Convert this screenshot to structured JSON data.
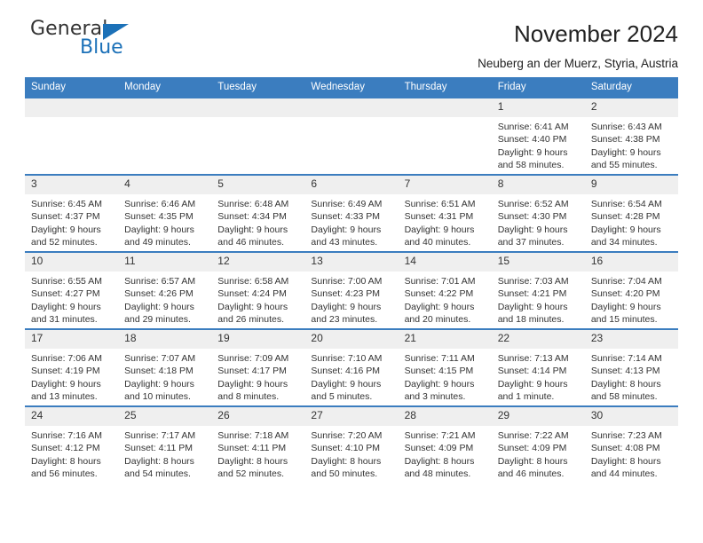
{
  "logo": {
    "word_one": "General",
    "word_two": "Blue",
    "triangle": "triangle-mark",
    "accent_color": "#1c71b8"
  },
  "header": {
    "title": "November 2024",
    "subtitle": "Neuberg an der Muerz, Styria, Austria"
  },
  "theme": {
    "header_blue": "#3b7dbf",
    "daynum_band": "#efefef",
    "text": "#333333"
  },
  "weekday_headers": [
    "Sunday",
    "Monday",
    "Tuesday",
    "Wednesday",
    "Thursday",
    "Friday",
    "Saturday"
  ],
  "weeks": [
    [
      {
        "day": "",
        "empty": true,
        "sunrise": "",
        "sunset": "",
        "daylight_line1": "",
        "daylight_line2": ""
      },
      {
        "day": "",
        "empty": true,
        "sunrise": "",
        "sunset": "",
        "daylight_line1": "",
        "daylight_line2": ""
      },
      {
        "day": "",
        "empty": true,
        "sunrise": "",
        "sunset": "",
        "daylight_line1": "",
        "daylight_line2": ""
      },
      {
        "day": "",
        "empty": true,
        "sunrise": "",
        "sunset": "",
        "daylight_line1": "",
        "daylight_line2": ""
      },
      {
        "day": "",
        "empty": true,
        "sunrise": "",
        "sunset": "",
        "daylight_line1": "",
        "daylight_line2": ""
      },
      {
        "day": "1",
        "empty": false,
        "sunrise": "Sunrise: 6:41 AM",
        "sunset": "Sunset: 4:40 PM",
        "daylight_line1": "Daylight: 9 hours",
        "daylight_line2": "and 58 minutes."
      },
      {
        "day": "2",
        "empty": false,
        "sunrise": "Sunrise: 6:43 AM",
        "sunset": "Sunset: 4:38 PM",
        "daylight_line1": "Daylight: 9 hours",
        "daylight_line2": "and 55 minutes."
      }
    ],
    [
      {
        "day": "3",
        "empty": false,
        "sunrise": "Sunrise: 6:45 AM",
        "sunset": "Sunset: 4:37 PM",
        "daylight_line1": "Daylight: 9 hours",
        "daylight_line2": "and 52 minutes."
      },
      {
        "day": "4",
        "empty": false,
        "sunrise": "Sunrise: 6:46 AM",
        "sunset": "Sunset: 4:35 PM",
        "daylight_line1": "Daylight: 9 hours",
        "daylight_line2": "and 49 minutes."
      },
      {
        "day": "5",
        "empty": false,
        "sunrise": "Sunrise: 6:48 AM",
        "sunset": "Sunset: 4:34 PM",
        "daylight_line1": "Daylight: 9 hours",
        "daylight_line2": "and 46 minutes."
      },
      {
        "day": "6",
        "empty": false,
        "sunrise": "Sunrise: 6:49 AM",
        "sunset": "Sunset: 4:33 PM",
        "daylight_line1": "Daylight: 9 hours",
        "daylight_line2": "and 43 minutes."
      },
      {
        "day": "7",
        "empty": false,
        "sunrise": "Sunrise: 6:51 AM",
        "sunset": "Sunset: 4:31 PM",
        "daylight_line1": "Daylight: 9 hours",
        "daylight_line2": "and 40 minutes."
      },
      {
        "day": "8",
        "empty": false,
        "sunrise": "Sunrise: 6:52 AM",
        "sunset": "Sunset: 4:30 PM",
        "daylight_line1": "Daylight: 9 hours",
        "daylight_line2": "and 37 minutes."
      },
      {
        "day": "9",
        "empty": false,
        "sunrise": "Sunrise: 6:54 AM",
        "sunset": "Sunset: 4:28 PM",
        "daylight_line1": "Daylight: 9 hours",
        "daylight_line2": "and 34 minutes."
      }
    ],
    [
      {
        "day": "10",
        "empty": false,
        "sunrise": "Sunrise: 6:55 AM",
        "sunset": "Sunset: 4:27 PM",
        "daylight_line1": "Daylight: 9 hours",
        "daylight_line2": "and 31 minutes."
      },
      {
        "day": "11",
        "empty": false,
        "sunrise": "Sunrise: 6:57 AM",
        "sunset": "Sunset: 4:26 PM",
        "daylight_line1": "Daylight: 9 hours",
        "daylight_line2": "and 29 minutes."
      },
      {
        "day": "12",
        "empty": false,
        "sunrise": "Sunrise: 6:58 AM",
        "sunset": "Sunset: 4:24 PM",
        "daylight_line1": "Daylight: 9 hours",
        "daylight_line2": "and 26 minutes."
      },
      {
        "day": "13",
        "empty": false,
        "sunrise": "Sunrise: 7:00 AM",
        "sunset": "Sunset: 4:23 PM",
        "daylight_line1": "Daylight: 9 hours",
        "daylight_line2": "and 23 minutes."
      },
      {
        "day": "14",
        "empty": false,
        "sunrise": "Sunrise: 7:01 AM",
        "sunset": "Sunset: 4:22 PM",
        "daylight_line1": "Daylight: 9 hours",
        "daylight_line2": "and 20 minutes."
      },
      {
        "day": "15",
        "empty": false,
        "sunrise": "Sunrise: 7:03 AM",
        "sunset": "Sunset: 4:21 PM",
        "daylight_line1": "Daylight: 9 hours",
        "daylight_line2": "and 18 minutes."
      },
      {
        "day": "16",
        "empty": false,
        "sunrise": "Sunrise: 7:04 AM",
        "sunset": "Sunset: 4:20 PM",
        "daylight_line1": "Daylight: 9 hours",
        "daylight_line2": "and 15 minutes."
      }
    ],
    [
      {
        "day": "17",
        "empty": false,
        "sunrise": "Sunrise: 7:06 AM",
        "sunset": "Sunset: 4:19 PM",
        "daylight_line1": "Daylight: 9 hours",
        "daylight_line2": "and 13 minutes."
      },
      {
        "day": "18",
        "empty": false,
        "sunrise": "Sunrise: 7:07 AM",
        "sunset": "Sunset: 4:18 PM",
        "daylight_line1": "Daylight: 9 hours",
        "daylight_line2": "and 10 minutes."
      },
      {
        "day": "19",
        "empty": false,
        "sunrise": "Sunrise: 7:09 AM",
        "sunset": "Sunset: 4:17 PM",
        "daylight_line1": "Daylight: 9 hours",
        "daylight_line2": "and 8 minutes."
      },
      {
        "day": "20",
        "empty": false,
        "sunrise": "Sunrise: 7:10 AM",
        "sunset": "Sunset: 4:16 PM",
        "daylight_line1": "Daylight: 9 hours",
        "daylight_line2": "and 5 minutes."
      },
      {
        "day": "21",
        "empty": false,
        "sunrise": "Sunrise: 7:11 AM",
        "sunset": "Sunset: 4:15 PM",
        "daylight_line1": "Daylight: 9 hours",
        "daylight_line2": "and 3 minutes."
      },
      {
        "day": "22",
        "empty": false,
        "sunrise": "Sunrise: 7:13 AM",
        "sunset": "Sunset: 4:14 PM",
        "daylight_line1": "Daylight: 9 hours",
        "daylight_line2": "and 1 minute."
      },
      {
        "day": "23",
        "empty": false,
        "sunrise": "Sunrise: 7:14 AM",
        "sunset": "Sunset: 4:13 PM",
        "daylight_line1": "Daylight: 8 hours",
        "daylight_line2": "and 58 minutes."
      }
    ],
    [
      {
        "day": "24",
        "empty": false,
        "sunrise": "Sunrise: 7:16 AM",
        "sunset": "Sunset: 4:12 PM",
        "daylight_line1": "Daylight: 8 hours",
        "daylight_line2": "and 56 minutes."
      },
      {
        "day": "25",
        "empty": false,
        "sunrise": "Sunrise: 7:17 AM",
        "sunset": "Sunset: 4:11 PM",
        "daylight_line1": "Daylight: 8 hours",
        "daylight_line2": "and 54 minutes."
      },
      {
        "day": "26",
        "empty": false,
        "sunrise": "Sunrise: 7:18 AM",
        "sunset": "Sunset: 4:11 PM",
        "daylight_line1": "Daylight: 8 hours",
        "daylight_line2": "and 52 minutes."
      },
      {
        "day": "27",
        "empty": false,
        "sunrise": "Sunrise: 7:20 AM",
        "sunset": "Sunset: 4:10 PM",
        "daylight_line1": "Daylight: 8 hours",
        "daylight_line2": "and 50 minutes."
      },
      {
        "day": "28",
        "empty": false,
        "sunrise": "Sunrise: 7:21 AM",
        "sunset": "Sunset: 4:09 PM",
        "daylight_line1": "Daylight: 8 hours",
        "daylight_line2": "and 48 minutes."
      },
      {
        "day": "29",
        "empty": false,
        "sunrise": "Sunrise: 7:22 AM",
        "sunset": "Sunset: 4:09 PM",
        "daylight_line1": "Daylight: 8 hours",
        "daylight_line2": "and 46 minutes."
      },
      {
        "day": "30",
        "empty": false,
        "sunrise": "Sunrise: 7:23 AM",
        "sunset": "Sunset: 4:08 PM",
        "daylight_line1": "Daylight: 8 hours",
        "daylight_line2": "and 44 minutes."
      }
    ]
  ]
}
